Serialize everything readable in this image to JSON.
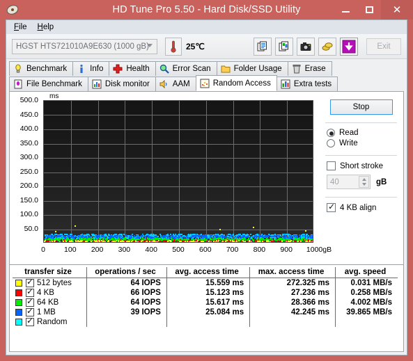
{
  "window": {
    "title": "HD Tune Pro 5.50 - Hard Disk/SSD Utility",
    "app_icon": "hdtune-disk-icon",
    "minimize_label": "–",
    "maximize_label": "□",
    "close_label": "✕",
    "frame_color": "#c9615c"
  },
  "menu": {
    "items": [
      {
        "label": "File",
        "mnemonic": "F"
      },
      {
        "label": "Help",
        "mnemonic": "H"
      }
    ]
  },
  "toolbar": {
    "drive": "HGST HTS721010A9E630 (1000 gB)",
    "temperature": "25℃",
    "buttons": [
      {
        "name": "copy-text-icon",
        "tooltip": "Copy text"
      },
      {
        "name": "copy-image-icon",
        "tooltip": "Copy image"
      },
      {
        "name": "camera-icon",
        "tooltip": "Screenshot"
      },
      {
        "name": "coins-icon",
        "tooltip": "Donate"
      },
      {
        "name": "download-arrow-icon",
        "tooltip": "Download"
      }
    ],
    "exit_label": "Exit"
  },
  "tabs": {
    "row1": [
      {
        "label": "Benchmark",
        "icon": "lightbulb-icon",
        "active": false
      },
      {
        "label": "Info",
        "icon": "info-icon",
        "active": false
      },
      {
        "label": "Health",
        "icon": "red-cross-icon",
        "active": false
      },
      {
        "label": "Error Scan",
        "icon": "magnifier-icon",
        "active": false
      },
      {
        "label": "Folder Usage",
        "icon": "folder-icon",
        "active": false
      },
      {
        "label": "Erase",
        "icon": "trash-icon",
        "active": false
      }
    ],
    "row2": [
      {
        "label": "File Benchmark",
        "icon": "file-benchmark-icon",
        "active": false
      },
      {
        "label": "Disk monitor",
        "icon": "bar-chart-icon",
        "active": false
      },
      {
        "label": "AAM",
        "icon": "speaker-icon",
        "active": false
      },
      {
        "label": "Random Access",
        "icon": "scatter-icon",
        "active": true
      },
      {
        "label": "Extra tests",
        "icon": "chart-grid-icon",
        "active": false
      }
    ]
  },
  "controls": {
    "stop_label": "Stop",
    "mode_read": {
      "label": "Read",
      "selected": true
    },
    "mode_write": {
      "label": "Write",
      "selected": false
    },
    "short_stroke": {
      "label": "Short stroke",
      "checked": false
    },
    "short_stroke_value": "40",
    "short_stroke_unit": "gB",
    "align_4kb": {
      "label": "4 KB align",
      "checked": true
    }
  },
  "chart_data": {
    "type": "scatter",
    "title": "",
    "xlabel": "gB",
    "ylabel": "ms",
    "xlim": [
      0,
      1000
    ],
    "ylim": [
      0,
      500
    ],
    "xticks": [
      "0",
      "100",
      "200",
      "300",
      "400",
      "500",
      "600",
      "700",
      "800",
      "900",
      "1000gB"
    ],
    "xtick_values": [
      0,
      100,
      200,
      300,
      400,
      500,
      600,
      700,
      800,
      900,
      1000
    ],
    "yticks": [
      "500.0",
      "450.0",
      "400.0",
      "350.0",
      "300.0",
      "250.0",
      "200.0",
      "150.0",
      "100.0",
      "50.0"
    ],
    "ytick_values": [
      500,
      450,
      400,
      350,
      300,
      250,
      200,
      150,
      100,
      50
    ],
    "grid": true,
    "background": "#1b1b1b",
    "series": [
      {
        "name": "512 bytes",
        "color": "#ffff00",
        "avg_ms": 15.559,
        "max_ms": 272.325,
        "iops": 64
      },
      {
        "name": "4 KB",
        "color": "#ff0000",
        "avg_ms": 15.123,
        "max_ms": 27.236,
        "iops": 66
      },
      {
        "name": "64 KB",
        "color": "#00ff00",
        "avg_ms": 15.617,
        "max_ms": 28.366,
        "iops": 64
      },
      {
        "name": "1 MB",
        "color": "#0066ff",
        "avg_ms": 25.084,
        "max_ms": 42.245,
        "iops": 39
      },
      {
        "name": "Random",
        "color": "#00ffff",
        "avg_ms": null,
        "max_ms": null,
        "iops": null
      }
    ]
  },
  "results": {
    "headers": [
      "transfer size",
      "operations / sec",
      "avg. access time",
      "max. access time",
      "avg. speed"
    ],
    "rows": [
      {
        "color": "#ffff00",
        "checked": true,
        "size": "512 bytes",
        "iops": "64 IOPS",
        "avg_access": "15.559 ms",
        "max_access": "272.325 ms",
        "avg_speed": "0.031 MB/s"
      },
      {
        "color": "#ff0000",
        "checked": true,
        "size": "4 KB",
        "iops": "66 IOPS",
        "avg_access": "15.123 ms",
        "max_access": "27.236 ms",
        "avg_speed": "0.258 MB/s"
      },
      {
        "color": "#00ee00",
        "checked": true,
        "size": "64 KB",
        "iops": "64 IOPS",
        "avg_access": "15.617 ms",
        "max_access": "28.366 ms",
        "avg_speed": "4.002 MB/s"
      },
      {
        "color": "#0066ff",
        "checked": true,
        "size": "1 MB",
        "iops": "39 IOPS",
        "avg_access": "25.084 ms",
        "max_access": "42.245 ms",
        "avg_speed": "39.865 MB/s"
      },
      {
        "color": "#00ffff",
        "checked": true,
        "size": "Random",
        "iops": "",
        "avg_access": "",
        "max_access": "",
        "avg_speed": ""
      }
    ]
  }
}
